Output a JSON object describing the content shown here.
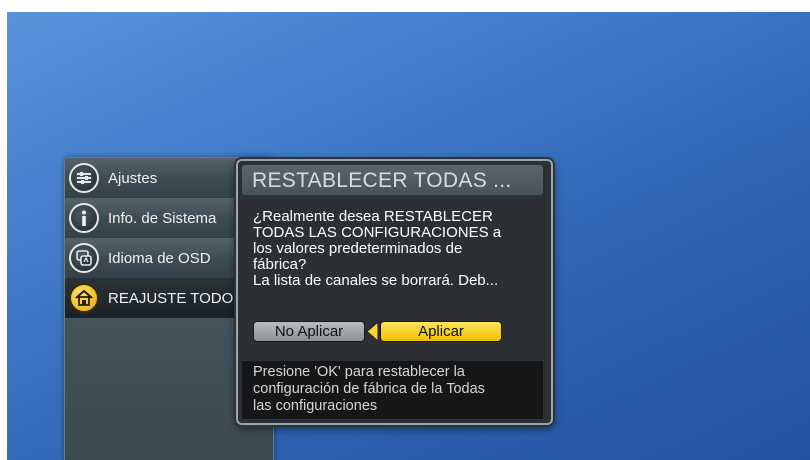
{
  "menu": {
    "items": [
      {
        "label": "Ajustes",
        "icon": "settings-sliders-icon"
      },
      {
        "label": "Info. de Sistema",
        "icon": "info-icon"
      },
      {
        "label": "Idioma de OSD",
        "icon": "language-icon"
      },
      {
        "label": "REAJUSTE TODO",
        "icon": "home-reset-icon",
        "selected": true
      }
    ]
  },
  "dialog": {
    "title": "RESTABLECER TODAS ...",
    "message_lines": [
      "¿Realmente desea RESTABLECER",
      "TODAS LAS CONFIGURACIONES a",
      "los valores predeterminados de",
      "fábrica?",
      "La lista de canales se borrará. Deb..."
    ],
    "no_button": "No Aplicar",
    "yes_button": "Aplicar",
    "footer_lines": [
      "Presione 'OK' para restablecer la",
      "configuración de fábrica de la Todas",
      "las configuraciones"
    ]
  },
  "colors": {
    "background": "#3f79c8",
    "highlight": "#f5c800",
    "panel": "#2c3034"
  }
}
